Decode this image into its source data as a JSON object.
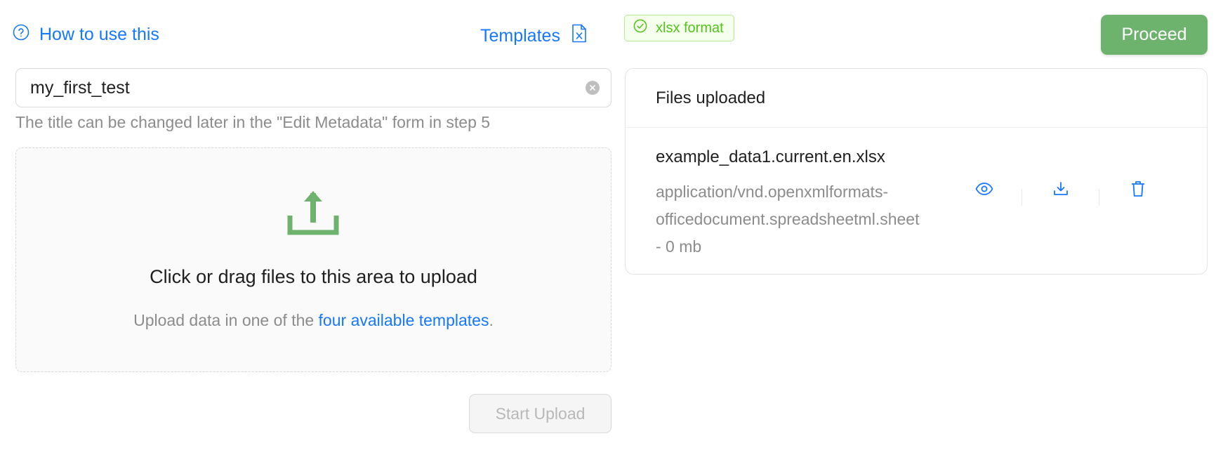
{
  "header": {
    "help_label": "How to use this",
    "templates_label": "Templates"
  },
  "title_input": {
    "value": "my_first_test",
    "hint": "The title can be changed later in the \"Edit Metadata\" form in step 5"
  },
  "dropzone": {
    "title": "Click or drag files to this area to upload",
    "hint_prefix": "Upload data in one of the ",
    "hint_link": "four available templates",
    "hint_suffix": "."
  },
  "start_upload_label": "Start Upload",
  "format_tag_label": "xlsx format",
  "proceed_label": "Proceed",
  "files_panel": {
    "title": "Files uploaded",
    "files": [
      {
        "name": "example_data1.current.en.xlsx",
        "description": "application/vnd.openxmlformats-officedocument.spreadsheetml.sheet - 0 mb"
      }
    ]
  },
  "colors": {
    "link_blue": "#1677ff",
    "accent_green": "#6db26d",
    "success_green": "#52c41a"
  },
  "icons": [
    "question-circle-icon",
    "file-excel-icon",
    "check-circle-icon",
    "upload-icon",
    "clear-icon",
    "eye-icon",
    "download-icon",
    "delete-icon"
  ]
}
